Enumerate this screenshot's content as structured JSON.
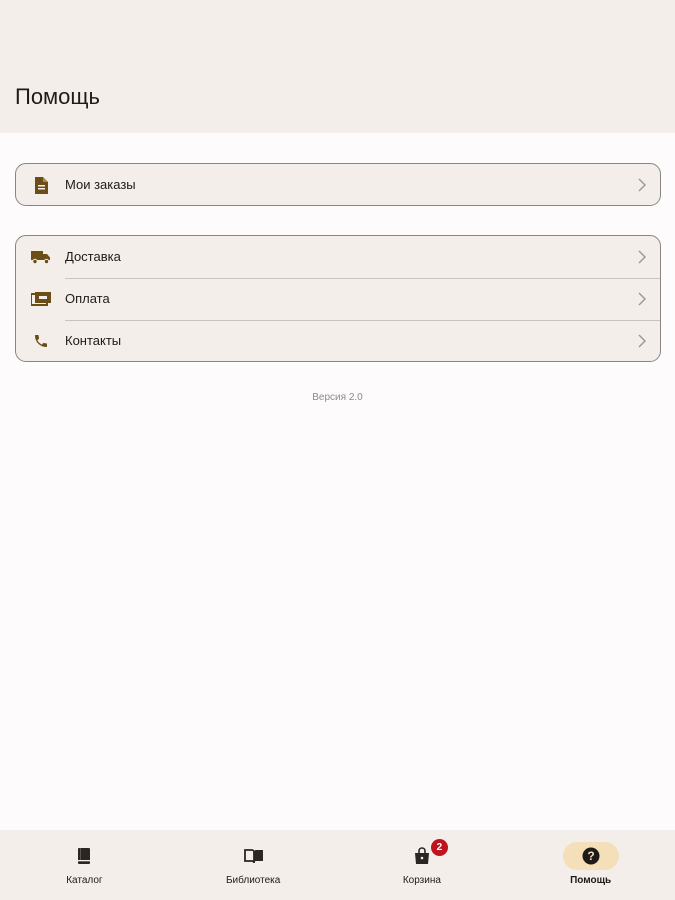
{
  "header": {
    "title": "Помощь"
  },
  "orders_card": {
    "items": [
      {
        "label": "Мои заказы",
        "icon": "document-icon"
      }
    ]
  },
  "help_card": {
    "items": [
      {
        "label": "Доставка",
        "icon": "truck-icon"
      },
      {
        "label": "Оплата",
        "icon": "payment-icon"
      },
      {
        "label": "Контакты",
        "icon": "phone-icon"
      }
    ]
  },
  "version": "Версия 2.0",
  "bottom_nav": {
    "items": [
      {
        "label": "Каталог",
        "icon": "book-icon",
        "active": false
      },
      {
        "label": "Библиотека",
        "icon": "open-book-icon",
        "active": false
      },
      {
        "label": "Корзина",
        "icon": "shopping-bag-icon",
        "active": false,
        "badge": "2"
      },
      {
        "label": "Помощь",
        "icon": "help-circle-icon",
        "active": true
      }
    ]
  },
  "colors": {
    "accent_icon": "#6b4e16",
    "surface": "#f4eeea",
    "active_pill": "#f4dfb8",
    "badge": "#c1121f"
  }
}
